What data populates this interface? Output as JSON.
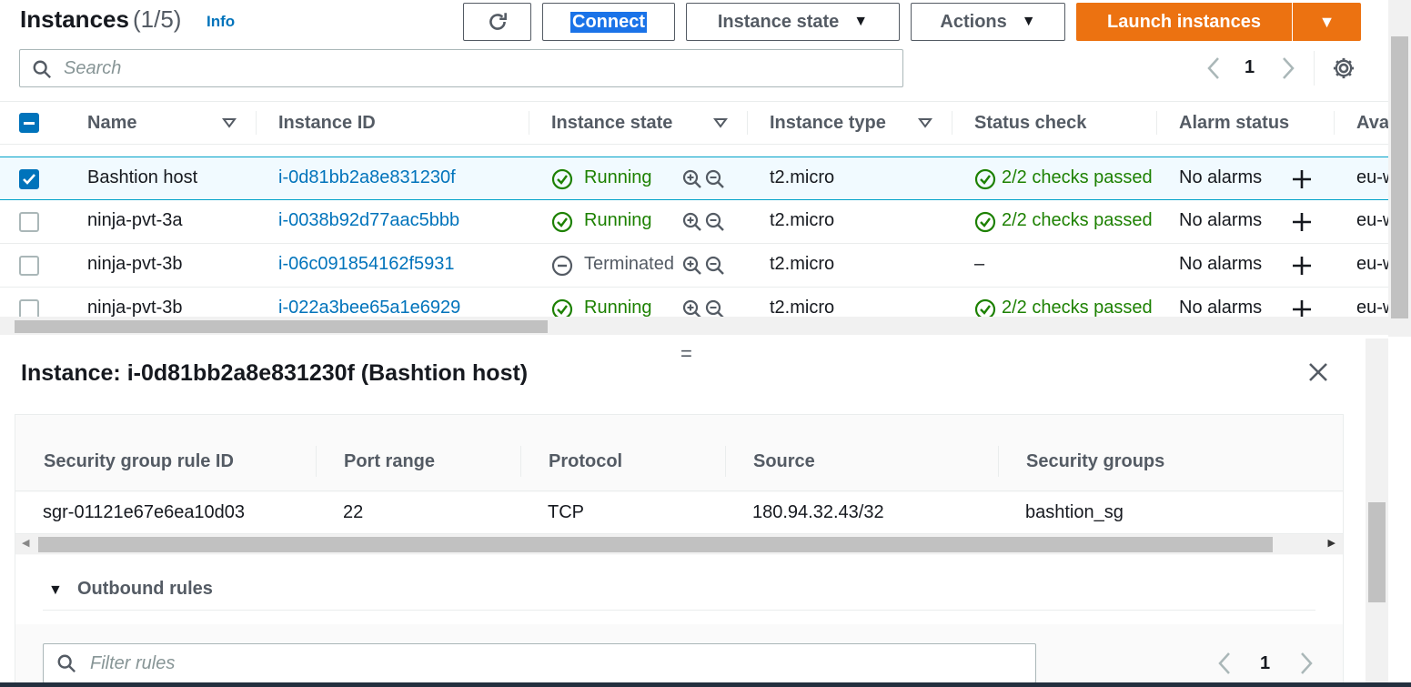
{
  "header": {
    "title": "Instances",
    "count": "(1/5)",
    "info": "Info",
    "connect": "Connect",
    "instance_state": "Instance state",
    "actions": "Actions",
    "launch": "Launch instances"
  },
  "search": {
    "placeholder": "Search"
  },
  "pagination": {
    "page": "1"
  },
  "table": {
    "columns": {
      "name": "Name",
      "instance_id": "Instance ID",
      "instance_state": "Instance state",
      "instance_type": "Instance type",
      "status_check": "Status check",
      "alarm_status": "Alarm status",
      "az": "Ava"
    },
    "rows": [
      {
        "name": "Bashtion host",
        "id": "i-0d81bb2a8e831230f",
        "state": "Running",
        "type": "t2.micro",
        "status": "2/2 checks passed",
        "alarm": "No alarms",
        "az": "eu-w",
        "selected": true
      },
      {
        "name": "ninja-pvt-3a",
        "id": "i-0038b92d77aac5bbb",
        "state": "Running",
        "type": "t2.micro",
        "status": "2/2 checks passed",
        "alarm": "No alarms",
        "az": "eu-w",
        "selected": false
      },
      {
        "name": "ninja-pvt-3b",
        "id": "i-06c091854162f5931",
        "state": "Terminated",
        "type": "t2.micro",
        "status": "–",
        "alarm": "No alarms",
        "az": "eu-w",
        "selected": false
      },
      {
        "name": "ninja-pvt-3b",
        "id": "i-022a3bee65a1e6929",
        "state": "Running",
        "type": "t2.micro",
        "status": "2/2 checks passed",
        "alarm": "No alarms",
        "az": "eu-w",
        "selected": false
      }
    ]
  },
  "detail": {
    "title": "Instance: i-0d81bb2a8e831230f (Bashtion host)",
    "sg_columns": {
      "rule_id": "Security group rule ID",
      "port_range": "Port range",
      "protocol": "Protocol",
      "source": "Source",
      "groups": "Security groups"
    },
    "sg_row": {
      "rule_id": "sgr-01121e67e6ea10d03",
      "port_range": "22",
      "protocol": "TCP",
      "source": "180.94.32.43/32",
      "groups": "bashtion_sg"
    },
    "outbound_label": "Outbound rules",
    "filter_placeholder": "Filter rules",
    "page": "1"
  },
  "colors": {
    "accent": "#ec7211",
    "link": "#0073bb",
    "success": "#1d8102"
  },
  "icons": [
    "refresh-icon",
    "caret-down-icon",
    "search-icon",
    "chevron-left-icon",
    "chevron-right-icon",
    "settings-icon",
    "sort-icon",
    "check-circle-icon",
    "minus-circle-icon",
    "zoom-in-icon",
    "zoom-out-icon",
    "plus-icon",
    "close-icon"
  ]
}
